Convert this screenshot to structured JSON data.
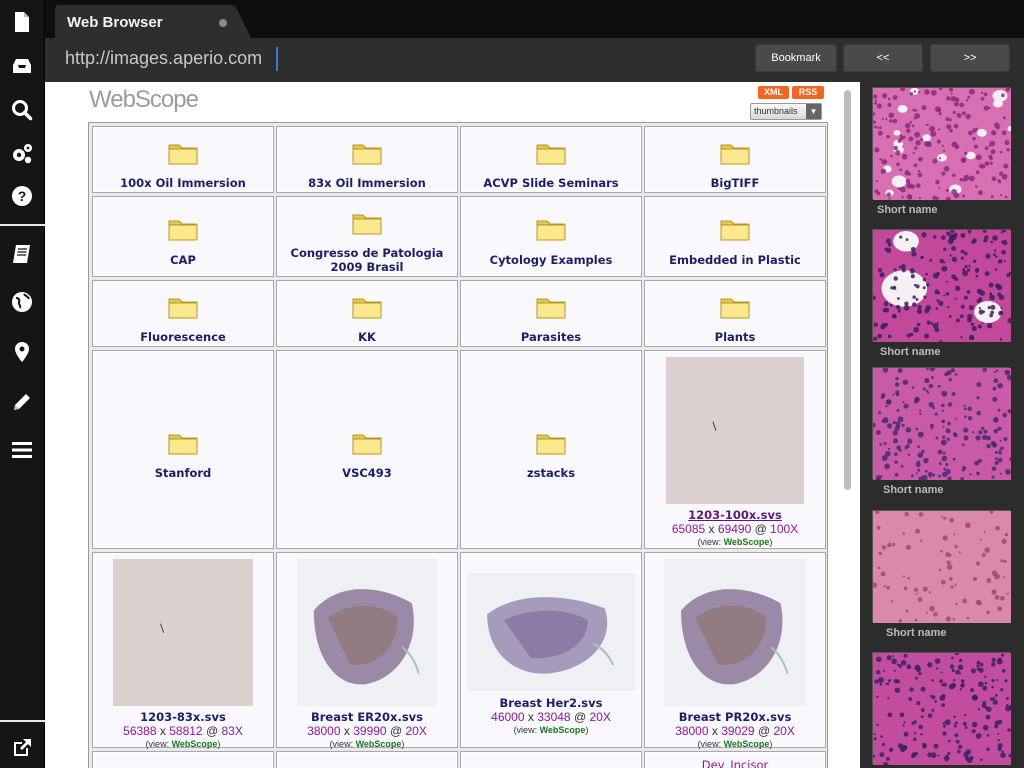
{
  "tab": {
    "title": "Web Browser"
  },
  "toolbar": {
    "url": "http://images.aperio.com",
    "bookmark_label": "Bookmark",
    "back_label": "<<",
    "forward_label": ">>"
  },
  "rail": {
    "icons": [
      "document-icon",
      "inbox-icon",
      "search-icon",
      "gears-icon",
      "help-icon",
      "notebook-icon",
      "globe-icon",
      "map-pin-icon",
      "pencil-icon",
      "list-icon",
      "external-link-icon"
    ]
  },
  "page": {
    "logo": "WebScope",
    "xml_label": "XML",
    "rss_label": "RSS",
    "view_mode": "thumbnails",
    "folders": [
      {
        "label": "100x Oil Immersion"
      },
      {
        "label": "83x Oil Immersion"
      },
      {
        "label": "ACVP Slide Seminars"
      },
      {
        "label": "BigTIFF"
      },
      {
        "label": "CAP"
      },
      {
        "label": "Congresso de Patologia 2009 Brasil"
      },
      {
        "label": "Cytology Examples"
      },
      {
        "label": "Embedded in Plastic"
      },
      {
        "label": "Fluorescence"
      },
      {
        "label": "KK"
      },
      {
        "label": "Parasites"
      },
      {
        "label": "Plants"
      },
      {
        "label": "Stanford"
      },
      {
        "label": "VSC493"
      },
      {
        "label": "zstacks"
      }
    ],
    "slides": [
      {
        "name": "1203-100x.svs",
        "width": "65085",
        "height": "69490",
        "mag": "100X",
        "view_prefix": "(view: ",
        "view_link": "WebScope",
        "view_suffix": ")"
      },
      {
        "name": "1203-83x.svs",
        "width": "56388",
        "height": "58812",
        "mag": "83X",
        "view_prefix": "(view: ",
        "view_link": "WebScope",
        "view_suffix": ")"
      },
      {
        "name": "Breast ER20x.svs",
        "width": "38000",
        "height": "39990",
        "mag": "20X",
        "view_prefix": "(view: ",
        "view_link": "WebScope",
        "view_suffix": ")"
      },
      {
        "name": "Breast Her2.svs",
        "width": "46000",
        "height": "33048",
        "mag": "20X",
        "view_prefix": "(view: ",
        "view_link": "WebScope",
        "view_suffix": ")"
      },
      {
        "name": "Breast PR20x.svs",
        "width": "38000",
        "height": "39029",
        "mag": "20X",
        "view_prefix": "(view: ",
        "view_link": "WebScope",
        "view_suffix": ")"
      }
    ],
    "x_sep": "x",
    "at_sep": "@",
    "partial_link": "Dev_Incisor"
  },
  "side_panel": {
    "items": [
      {
        "name": "Short name"
      },
      {
        "name": "Short name"
      },
      {
        "name": "Short name"
      },
      {
        "name": "Short name"
      },
      {
        "name": ""
      }
    ]
  },
  "colors": {
    "accent_orange": "#f26522",
    "link_navy": "#1c1f66",
    "dims_purple": "#8a1a9a",
    "webscope_green": "#1a7a1a",
    "caret_blue": "#3a7bd5"
  }
}
